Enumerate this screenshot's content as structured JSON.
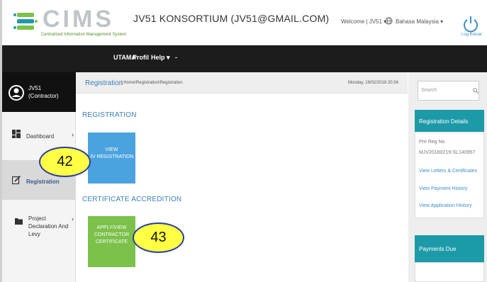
{
  "app": {
    "logo_text": "CIMS",
    "logo_subtitle": "Centralized Information Management System",
    "title": "JV51 KONSORTIUM (JV51@GMAIL.COM)",
    "welcome": "Welcome | JV51 ▾",
    "language": "Bahasa Malaysia ▾",
    "logout_label": "Log Keluar"
  },
  "topnav": {
    "items": [
      {
        "label": "UTAMA"
      },
      {
        "label": "Profil"
      },
      {
        "label": "Help ▾"
      },
      {
        "label": "-"
      }
    ]
  },
  "sidebar": {
    "user": {
      "name": "JV51",
      "role": "(Contractor)"
    },
    "items": [
      {
        "label": "Dashboard",
        "icon": "dashboard-icon"
      },
      {
        "label": "Registration",
        "icon": "edit-icon"
      },
      {
        "label": "Project Declaration And Levy",
        "icon": "folder-icon"
      }
    ]
  },
  "breadcrumb": {
    "title": "Registration",
    "path": "| Home\\Registration\\Registration",
    "date": "Monday, 19/02/2018 20:34"
  },
  "sections": [
    {
      "title": "REGISTRATION",
      "tile_lines": [
        "VIEW",
        "JV REGISTRATION"
      ],
      "tile_color": "#4aa3df"
    },
    {
      "title": "CERTIFICATE ACCREDITION",
      "tile_lines": [
        "APPLY/VIEW",
        "CONTRACTOR",
        "CERTIFICATE"
      ],
      "tile_color": "#7cc14a"
    }
  ],
  "right_panel": {
    "search_placeholder": "Search",
    "registration_details": {
      "heading": "Registration Details",
      "pre_reg_label": "Pre Reg No",
      "pre_reg_value": "MJV20180219-SL140957",
      "links": [
        "View Letters & Certificates",
        "View Payment History",
        "View Application History"
      ]
    },
    "payments_due": {
      "heading": "Payments Due"
    }
  },
  "callouts": [
    {
      "number": "42"
    },
    {
      "number": "43"
    }
  ],
  "colors": {
    "accent_blue": "#4aa3df",
    "accent_green": "#7cc14a",
    "teal": "#1d9aa8",
    "nav_dark": "#1c1c1c",
    "callout_fill": "#ffff44",
    "callout_border": "#2a3f9e"
  }
}
